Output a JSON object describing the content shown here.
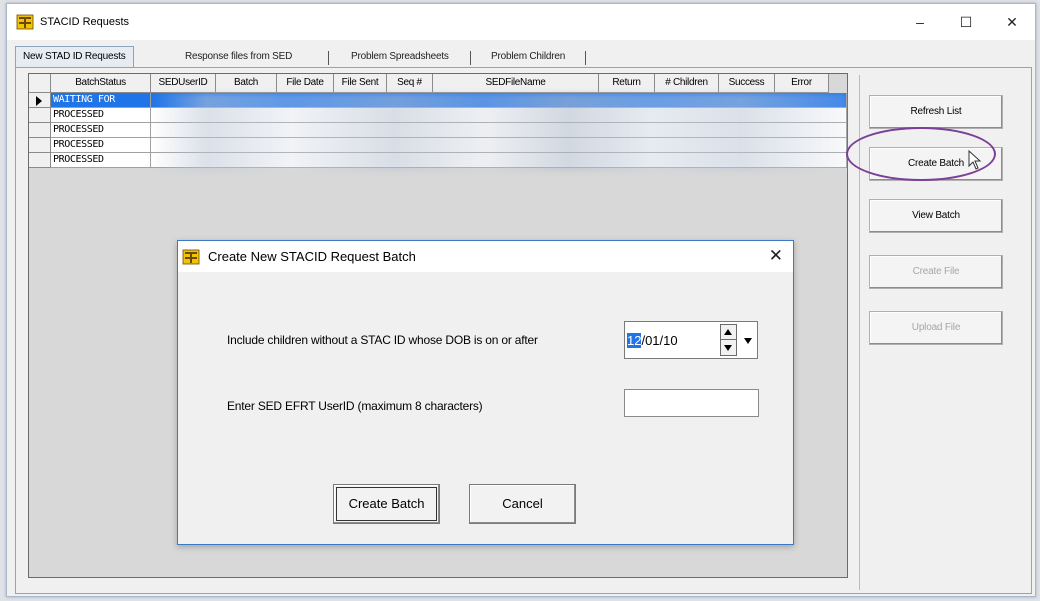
{
  "window": {
    "title": "STACID Requests",
    "minimize_glyph": "–",
    "maximize_glyph": "☐",
    "close_glyph": "✕"
  },
  "tabs": [
    {
      "label": "New STAD ID Requests",
      "active": true
    },
    {
      "label": "Response files from SED",
      "active": false
    },
    {
      "label": "Problem Spreadsheets",
      "active": false
    },
    {
      "label": "Problem Children",
      "active": false
    }
  ],
  "grid": {
    "columns": [
      "BatchStatus",
      "SEDUserID",
      "Batch",
      "File Date",
      "File Sent",
      "Seq #",
      "SEDFileName",
      "Return",
      "# Children",
      "Success",
      "Error"
    ],
    "rows": [
      {
        "status": "WAITING FOR",
        "selected": true
      },
      {
        "status": "PROCESSED",
        "selected": false
      },
      {
        "status": "PROCESSED",
        "selected": false
      },
      {
        "status": "PROCESSED",
        "selected": false
      },
      {
        "status": "PROCESSED",
        "selected": false
      }
    ]
  },
  "side_buttons": {
    "refresh": "Refresh List",
    "create_batch": "Create Batch",
    "view_batch": "View Batch",
    "create_file": "Create File",
    "upload_file": "Upload File"
  },
  "dialog": {
    "title": "Create New STACID Request Batch",
    "close_glyph": "✕",
    "dob_label": "Include children without a STAC ID whose DOB is  on or after",
    "date_month": "12",
    "date_rest": "/01/10",
    "userid_label": "Enter SED EFRT UserID (maximum 8 characters)",
    "userid_value": "",
    "create_button": "Create Batch",
    "cancel_button": "Cancel"
  },
  "colors": {
    "selection": "#1f74e8",
    "highlight_ring": "#7b3f98",
    "tab_border": "#8ea3bd"
  }
}
